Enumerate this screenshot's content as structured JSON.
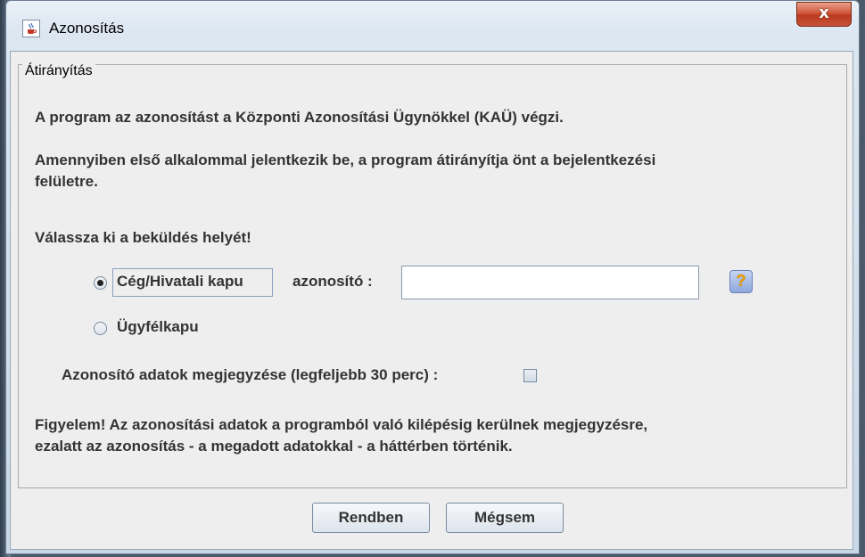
{
  "window": {
    "title": "Azonosítás",
    "close_label": "x"
  },
  "group": {
    "legend": "Átirányítás"
  },
  "body": {
    "intro": "A program az azonosítást a Központi Azonosítási Ügynökkel (KAÜ) végzi.",
    "redirect_line1": "Amennyiben első alkalommal jelentkezik be, a program átirányítja önt a bejelentkezési",
    "redirect_line2": "felületre.",
    "choose_label": "Válassza ki a beküldés helyét!",
    "option_company": "Cég/Hivatali kapu",
    "id_label": "azonosító :",
    "id_value": "",
    "option_client": "Ügyfélkapu",
    "remember_label": "Azonosító adatok megjegyzése (legfeljebb 30 perc) :",
    "remember_checked": false,
    "warning_line1": "Figyelem! Az azonosítási adatok a programból való kilépésig kerülnek megjegyzésre,",
    "warning_line2": "ezalatt az azonosítás - a megadott adatokkal - a háttérben történik."
  },
  "buttons": {
    "ok": "Rendben",
    "cancel": "Mégsem"
  },
  "icons": {
    "app": "java-cup-icon",
    "help": "help-icon"
  }
}
